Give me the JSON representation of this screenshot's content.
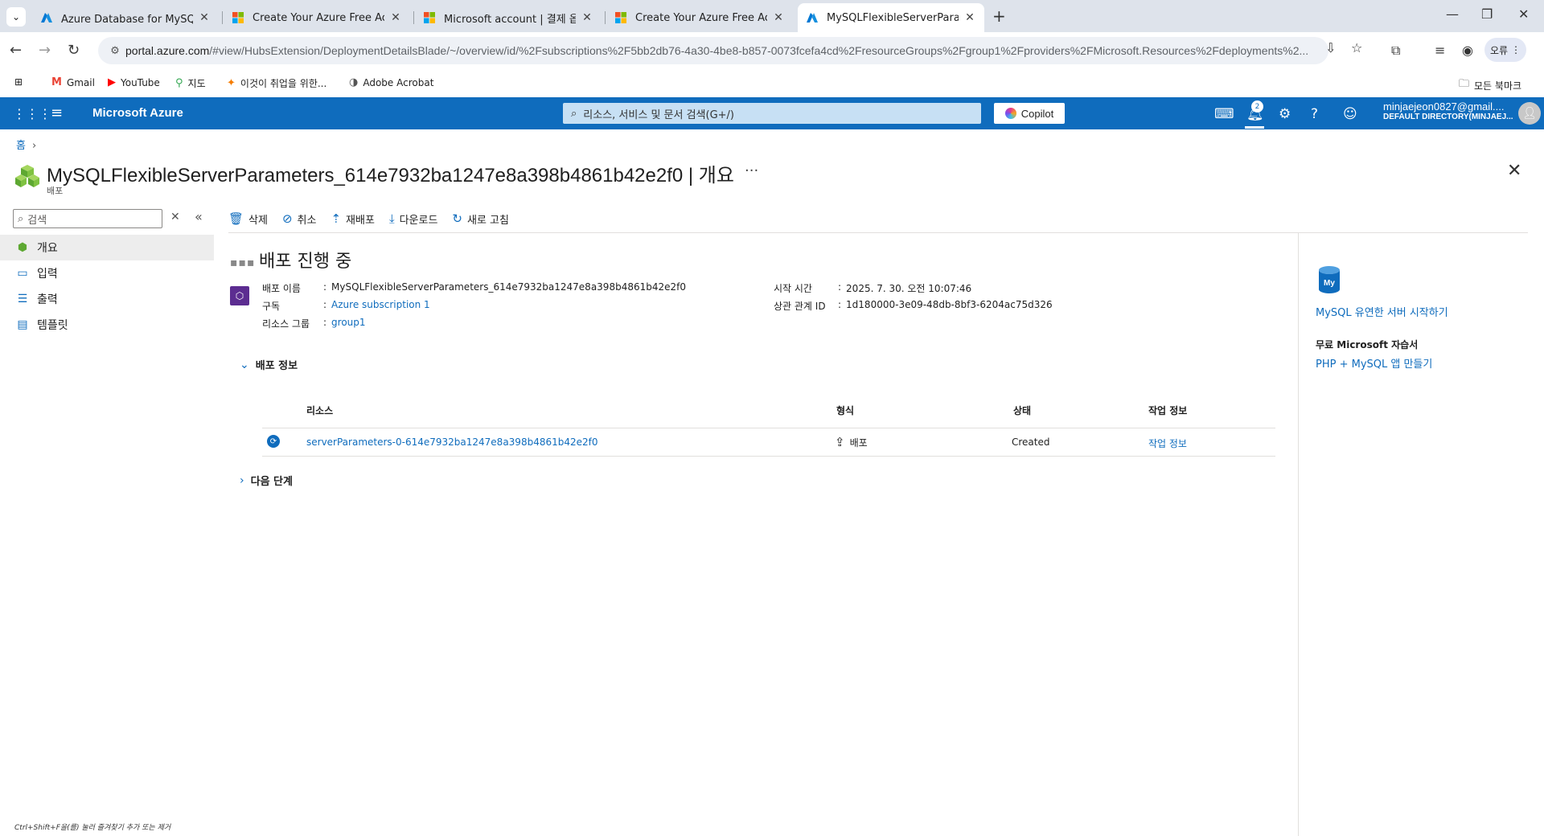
{
  "browser": {
    "tabs": [
      {
        "title": "Azure Database for MySQL 유",
        "icon": "azure-icon"
      },
      {
        "title": "Create Your Azure Free Accou",
        "icon": "microsoft-icon"
      },
      {
        "title": "Microsoft account | 결제 옵션",
        "icon": "microsoft-icon"
      },
      {
        "title": "Create Your Azure Free Accou",
        "icon": "microsoft-icon"
      },
      {
        "title": "MySQLFlexibleServerParamete",
        "icon": "azure-icon",
        "active": true
      }
    ],
    "url_host": "portal.azure.com",
    "url_path": "/#view/HubsExtension/DeploymentDetailsBlade/~/overview/id/%2Fsubscriptions%2F5bb2db76-4a30-4be8-b857-0073fcefa4cd%2FresourceGroups%2Fgroup1%2Fproviders%2FMicrosoft.Resources%2Fdeployments%2...",
    "error_label": "오류",
    "bookmarks": [
      {
        "label": "Gmail",
        "icon": "gmail-icon"
      },
      {
        "label": "YouTube",
        "icon": "youtube-icon"
      },
      {
        "label": "지도",
        "icon": "maps-icon"
      },
      {
        "label": "이것이 취업을 위한...",
        "icon": "bookmark-icon"
      },
      {
        "label": "Adobe Acrobat",
        "icon": "acrobat-icon"
      }
    ],
    "all_bookmarks": "모든 북마크"
  },
  "azure": {
    "brand": "Microsoft Azure",
    "search_placeholder": "리소스, 서비스 및 문서 검색(G+/)",
    "copilot": "Copilot",
    "notification_count": "2",
    "account_email": "minjaejeon0827@gmail....",
    "account_directory": "DEFAULT DIRECTORY(MINJAEJ..."
  },
  "page": {
    "breadcrumb_home": "홈",
    "title": "MySQLFlexibleServerParameters_614e7932ba1247e8a398b4861b42e2f0 | 개요",
    "subtitle": "배포",
    "more": "···"
  },
  "left_menu": {
    "search_placeholder": "검색",
    "items": [
      {
        "label": "개요",
        "icon": "overview-icon",
        "selected": true
      },
      {
        "label": "입력",
        "icon": "inputs-icon"
      },
      {
        "label": "출력",
        "icon": "outputs-icon"
      },
      {
        "label": "템플릿",
        "icon": "template-icon"
      }
    ],
    "hint": "Ctrl+Shift+F을(를) 눌러 즐겨찾기 추가 또는 제거"
  },
  "commands": [
    {
      "label": "삭제",
      "icon": "trash-icon"
    },
    {
      "label": "취소",
      "icon": "cancel-icon"
    },
    {
      "label": "재배포",
      "icon": "redeploy-icon"
    },
    {
      "label": "다운로드",
      "icon": "download-icon"
    },
    {
      "label": "새로 고침",
      "icon": "refresh-icon"
    }
  ],
  "deployment": {
    "status_title": "배포 진행 중",
    "name_label": "배포 이름",
    "name_value": "MySQLFlexibleServerParameters_614e7932ba1247e8a398b4861b42e2f0",
    "subscription_label": "구독",
    "subscription_value": "Azure subscription 1",
    "rg_label": "리소스 그룹",
    "rg_value": "group1",
    "start_label": "시작 시간",
    "start_value": "2025. 7. 30. 오전 10:07:46",
    "corr_label": "상관 관계 ID",
    "corr_value": "1d180000-3e09-48db-8bf3-6204ac75d326",
    "details_section": "배포 정보",
    "next_section": "다음 단계",
    "table": {
      "headers": [
        "리소스",
        "형식",
        "상태",
        "작업 정보"
      ],
      "rows": [
        {
          "resource": "serverParameters-0-614e7932ba1247e8a398b4861b42e2f0",
          "type": "배포",
          "status": "Created",
          "op": "작업 정보"
        }
      ]
    }
  },
  "right_panel": {
    "start_link": "MySQL 유연한 서버 시작하기",
    "learn_head": "무료 Microsoft 자습서",
    "learn_link": "PHP + MySQL 앱 만들기"
  }
}
